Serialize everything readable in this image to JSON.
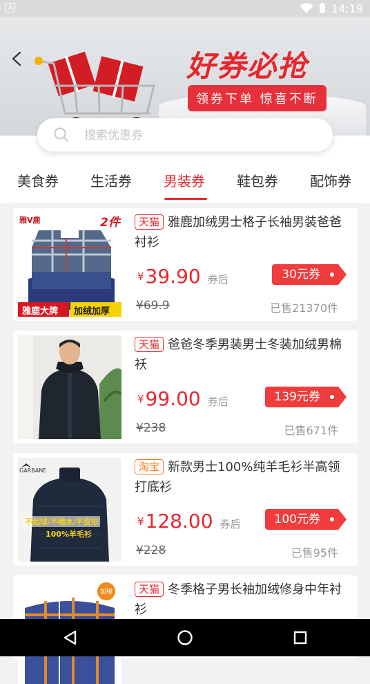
{
  "status_bar": {
    "app_icon_letter": "A",
    "time": "14:19"
  },
  "banner": {
    "headline": "好券必抢",
    "subline": "领券下单 惊喜不断"
  },
  "search": {
    "placeholder": "搜索优惠券"
  },
  "tabs": [
    {
      "label": "美食券",
      "active": false
    },
    {
      "label": "生活券",
      "active": false
    },
    {
      "label": "男装券",
      "active": true
    },
    {
      "label": "鞋包券",
      "active": false
    },
    {
      "label": "配饰券",
      "active": false
    }
  ],
  "products": [
    {
      "badge": "天猫",
      "title": "雅鹿加绒男士格子长袖男装爸爸衬衫",
      "yen": "¥",
      "price": "39.90",
      "price_suffix": "券后",
      "coupon": "30元券",
      "original_price": "¥69.9",
      "sold": "已售21370件",
      "thumb_texts": {
        "brand": "雅V鹿",
        "count": "2件",
        "left": "雅鹿大牌",
        "right": "加绒加厚"
      }
    },
    {
      "badge": "天猫",
      "title": "爸爸冬季男装男士冬装加绒男棉袄",
      "yen": "¥",
      "price": "99.00",
      "price_suffix": "券后",
      "coupon": "139元券",
      "original_price": "¥238",
      "sold": "已售671件"
    },
    {
      "badge": "淘宝",
      "title": "新款男士100%纯羊毛衫半高领打底衫",
      "yen": "¥",
      "price": "128.00",
      "price_suffix": "券后",
      "coupon": "100元券",
      "original_price": "¥228",
      "sold": "已售95件",
      "thumb_texts": {
        "brand": "GARBANE",
        "line1": "不起球/不缩水/不变形",
        "line2": "100%羊毛衫"
      }
    },
    {
      "badge": "天猫",
      "title": "冬季格子男长袖加绒修身中年衬衫",
      "thumb_texts": {
        "tag": "加绒"
      }
    }
  ],
  "colors": {
    "accent": "#e8262d",
    "tmall": "#e8262d",
    "taobao": "#ff7a1a",
    "coupon": "#f03c3c"
  },
  "nav": {
    "back": "back-triangle-icon",
    "home": "home-circle-icon",
    "recents": "recents-square-icon"
  }
}
